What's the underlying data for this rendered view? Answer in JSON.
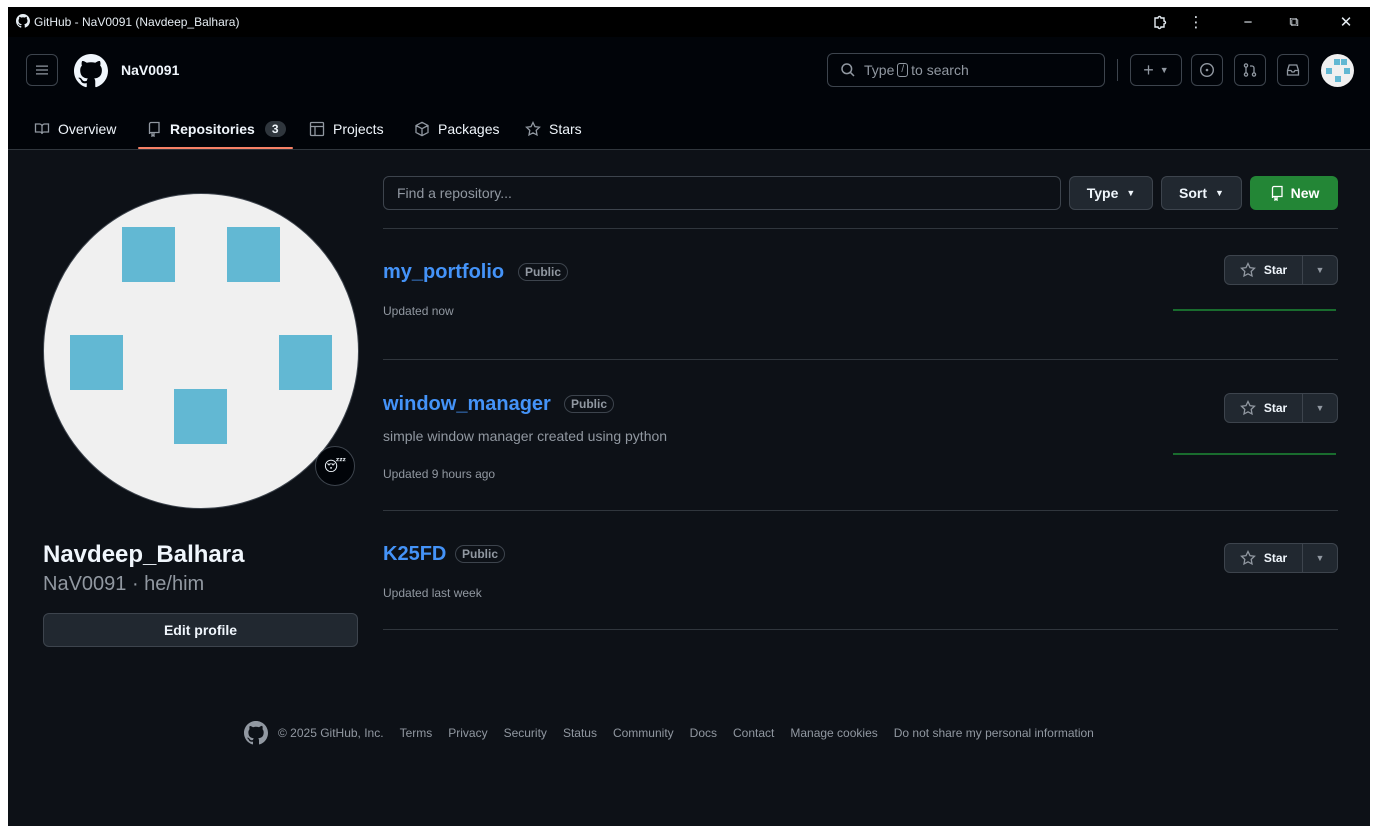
{
  "window": {
    "title": "GitHub - NaV0091 (Navdeep_Balhara)",
    "minimize": "−",
    "restore": "⧉",
    "close": "✕",
    "extensions": "⋮"
  },
  "header": {
    "username": "NaV0091",
    "search": {
      "prefix": "Type",
      "key": "/",
      "suffix": "to search"
    },
    "plus_label": "+"
  },
  "tabs": [
    {
      "label": "Overview",
      "icon": "book-icon"
    },
    {
      "label": "Repositories",
      "icon": "repo-icon",
      "count": "3"
    },
    {
      "label": "Projects",
      "icon": "table-icon"
    },
    {
      "label": "Packages",
      "icon": "package-icon"
    },
    {
      "label": "Stars",
      "icon": "star-icon"
    }
  ],
  "profile": {
    "fullname": "Navdeep_Balhara",
    "login": "NaV0091 · he/him",
    "edit_label": "Edit profile",
    "status_emoji": "😴"
  },
  "toolbar": {
    "find_placeholder": "Find a repository...",
    "type_label": "Type",
    "sort_label": "Sort",
    "new_label": "New"
  },
  "repos": [
    {
      "name": "my_portfolio",
      "visibility": "Public",
      "description": "",
      "updated": "Updated now",
      "star_label": "Star"
    },
    {
      "name": "window_manager",
      "visibility": "Public",
      "description": "simple window manager created using python",
      "updated": "Updated 9 hours ago",
      "star_label": "Star"
    },
    {
      "name": "K25FD",
      "visibility": "Public",
      "description": "",
      "updated": "Updated last week",
      "star_label": "Star"
    }
  ],
  "footer": {
    "copyright": "© 2025 GitHub, Inc.",
    "links": [
      "Terms",
      "Privacy",
      "Security",
      "Status",
      "Community",
      "Docs",
      "Contact",
      "Manage cookies",
      "Do not share my personal information"
    ]
  },
  "colors": {
    "bg": "#0d1117",
    "header_bg": "#010409",
    "link": "#4493f8",
    "primary_button": "#238636",
    "tab_underline": "#f78166",
    "avatar_tile": "#62b8d3"
  }
}
